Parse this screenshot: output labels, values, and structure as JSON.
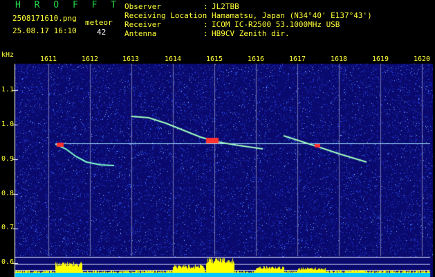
{
  "header": {
    "app_title": "H R O F F T",
    "file_name": "2508171610.png",
    "datetime": "25.08.17 16:10",
    "meteor_label": "meteor",
    "meteor_count": "42"
  },
  "info": {
    "rows": [
      {
        "label": "Observer",
        "value": "JL2TBB"
      },
      {
        "label": "Receiving Location",
        "value": "Hamamatsu, Japan (N34°40' E137°43')"
      },
      {
        "label": "Receiver",
        "value": "ICOM IC-R2500 53.1000MHz USB"
      },
      {
        "label": "Antenna",
        "value": "HB9CV Zenith dir."
      }
    ],
    "separator": ":"
  },
  "spectrogram": {
    "y_unit": "kHz",
    "x_ticks": [
      "1611",
      "1612",
      "1613",
      "1614",
      "1615",
      "1616",
      "1617",
      "1618",
      "1619",
      "1620"
    ],
    "y_ticks": [
      "1.1",
      "1.0",
      "0.9",
      "0.8",
      "0.7",
      "0.6"
    ],
    "colors": {
      "background": "#0a0a6e",
      "grid": "#c8c8dc",
      "trace": "#ff3030",
      "histogram": "#ffff00",
      "baseline": "#00c8ff"
    }
  }
}
